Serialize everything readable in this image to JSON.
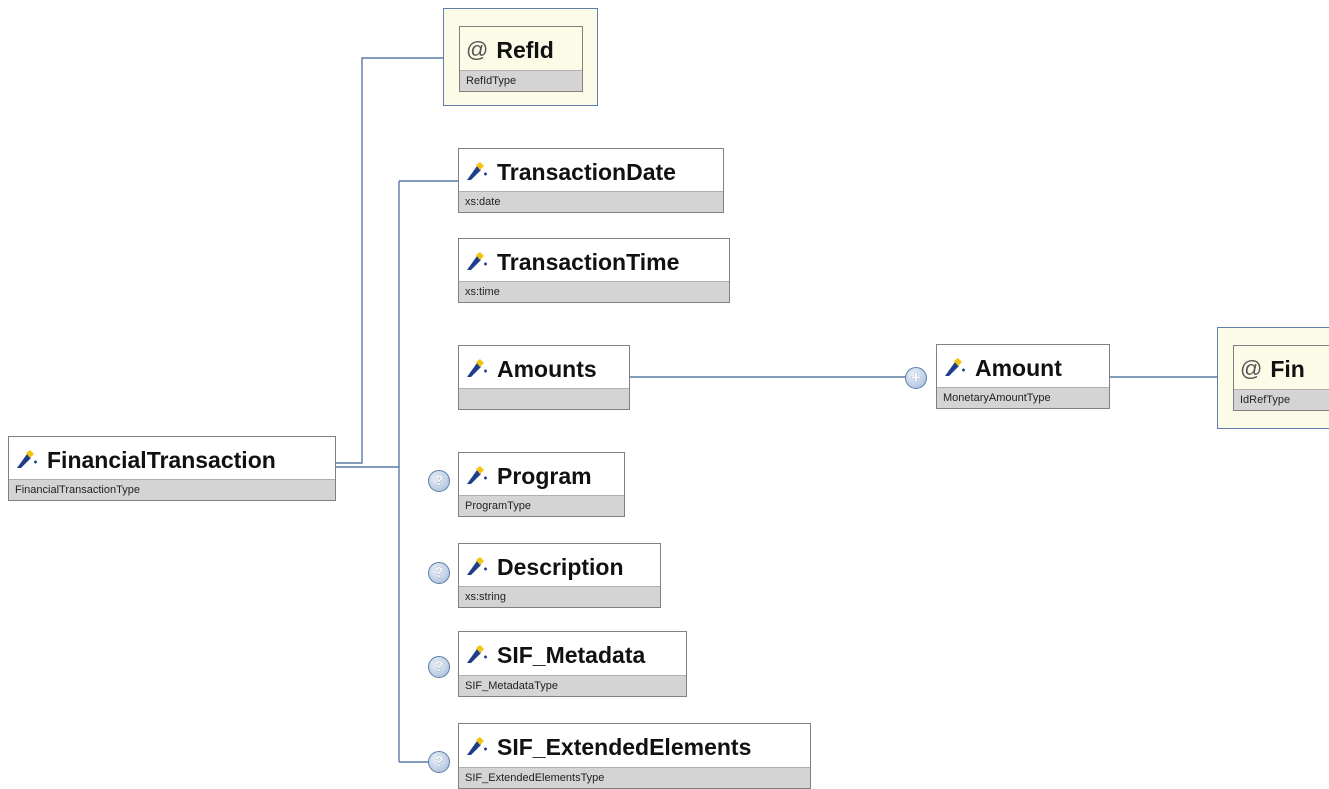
{
  "root": {
    "name": "FinancialTransaction",
    "type": "FinancialTransactionType"
  },
  "attribute": {
    "name": "RefId",
    "type": "RefIdType"
  },
  "children": [
    {
      "name": "TransactionDate",
      "type": "xs:date"
    },
    {
      "name": "TransactionTime",
      "type": "xs:time"
    },
    {
      "name": "Amounts",
      "type": ""
    },
    {
      "name": "Program",
      "type": "ProgramType"
    },
    {
      "name": "Description",
      "type": "xs:string"
    },
    {
      "name": "SIF_Metadata",
      "type": "SIF_MetadataType"
    },
    {
      "name": "SIF_ExtendedElements",
      "type": "SIF_ExtendedElementsType"
    }
  ],
  "amount": {
    "name": "Amount",
    "type": "MonetaryAmountType"
  },
  "amount_attribute": {
    "name": "Fin",
    "type": "IdRefType"
  },
  "glyphs": {
    "optional": "?",
    "expand": "+",
    "attribute": "@"
  },
  "colors": {
    "line": "#5b7ba6",
    "attribute_bg": "#fbfbe8",
    "type_bar": "#d4d4d4"
  }
}
